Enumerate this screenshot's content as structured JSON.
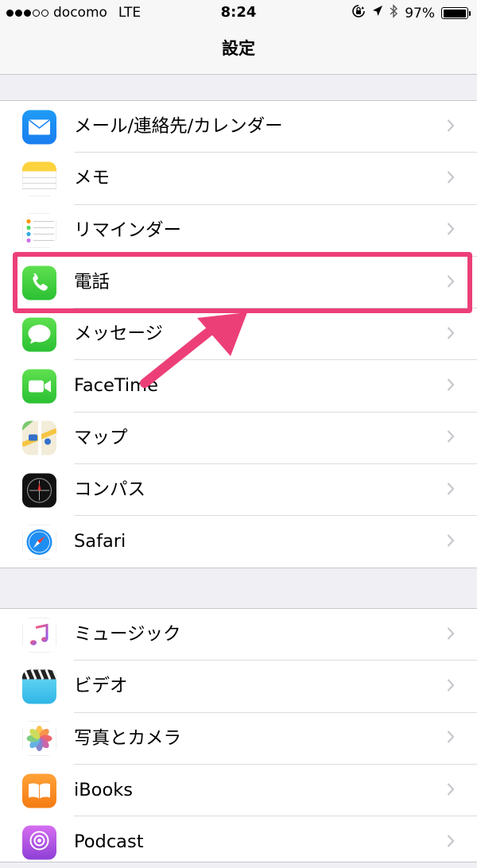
{
  "status_bar": {
    "carrier": "docomo",
    "network": "LTE",
    "time": "8:24",
    "battery_percent": "97%",
    "battery_level": 0.97,
    "signal_bars": 3,
    "signal_total": 5
  },
  "nav": {
    "title": "設定"
  },
  "groups": [
    {
      "items": [
        {
          "label": "メール/連絡先/カレンダー",
          "icon": "mail-icon"
        },
        {
          "label": "メモ",
          "icon": "notes-icon"
        },
        {
          "label": "リマインダー",
          "icon": "reminders-icon"
        },
        {
          "label": "電話",
          "icon": "phone-icon",
          "highlighted": true
        },
        {
          "label": "メッセージ",
          "icon": "messages-icon"
        },
        {
          "label": "FaceTime",
          "icon": "facetime-icon"
        },
        {
          "label": "マップ",
          "icon": "maps-icon"
        },
        {
          "label": "コンパス",
          "icon": "compass-icon"
        },
        {
          "label": "Safari",
          "icon": "safari-icon"
        }
      ]
    },
    {
      "items": [
        {
          "label": "ミュージック",
          "icon": "music-icon"
        },
        {
          "label": "ビデオ",
          "icon": "videos-icon"
        },
        {
          "label": "写真とカメラ",
          "icon": "photos-icon"
        },
        {
          "label": "iBooks",
          "icon": "ibooks-icon"
        },
        {
          "label": "Podcast",
          "icon": "podcast-icon"
        }
      ]
    }
  ],
  "colors": {
    "highlight": "#ec3f78",
    "background": "#efeff4",
    "chevron": "#c7c7cc"
  }
}
